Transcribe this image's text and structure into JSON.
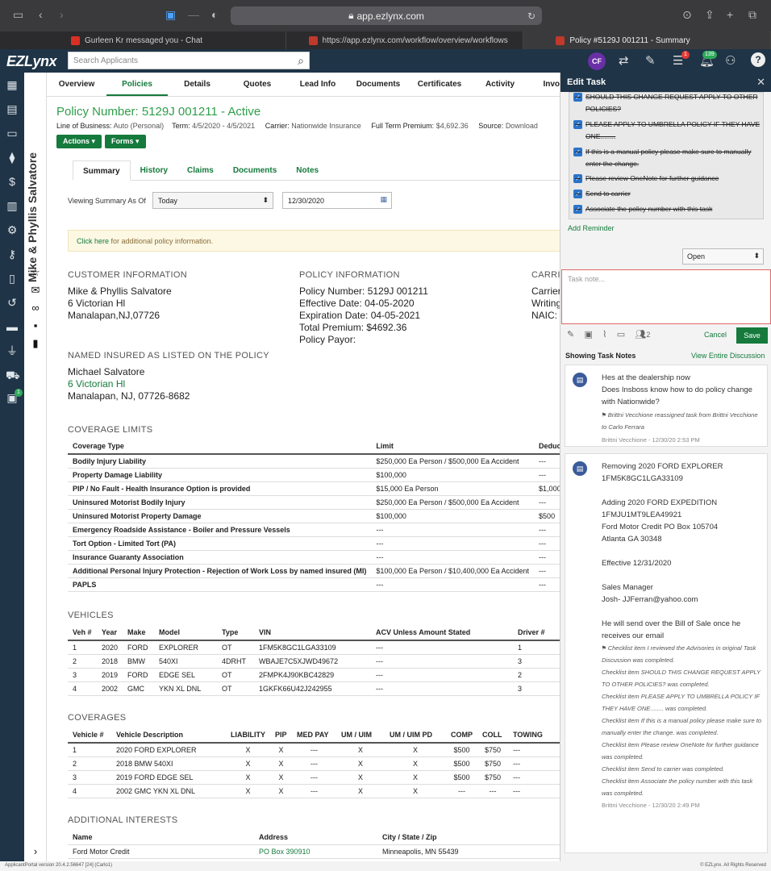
{
  "browser": {
    "url": "app.ezlynx.com",
    "tabs": [
      {
        "title": "Gurleen Kr messaged you - Chat"
      },
      {
        "title": "https://app.ezlynx.com/workflow/overview/workflows"
      },
      {
        "title": "Policy #5129J 001211 - Summary"
      }
    ]
  },
  "header": {
    "logo": "EZLynx",
    "search_placeholder": "Search Applicants",
    "avatar_initials": "CF",
    "list_badge": "1",
    "notif_badge": "139"
  },
  "sidebar_badge": "1",
  "client_name": "Mike & Phyllis Salvatore",
  "nav_tabs": [
    "Overview",
    "Policies",
    "Details",
    "Quotes",
    "Lead Info",
    "Documents",
    "Certificates",
    "Activity",
    "Invo"
  ],
  "policy": {
    "title": "Policy Number: 5129J 001211 - Active",
    "lob_label": "Line of Business:",
    "lob_value": "Auto (Personal)",
    "term_label": "Term:",
    "term_value": "4/5/2020 - 4/5/2021",
    "carrier_label": "Carrier:",
    "carrier_value": "Nationwide Insurance",
    "premium_label": "Full Term Premium:",
    "premium_value": "$4,692.36",
    "source_label": "Source:",
    "source_value": "Download",
    "actions_btn": "Actions",
    "forms_btn": "Forms"
  },
  "sub_tabs": [
    "Summary",
    "History",
    "Claims",
    "Documents",
    "Notes"
  ],
  "viewing": {
    "label": "Viewing Summary As Of",
    "select": "Today",
    "date": "12/30/2020"
  },
  "banner": {
    "link": "Click here",
    "text": " for additional policy information."
  },
  "customer_info": {
    "heading": "CUSTOMER INFORMATION",
    "name": "Mike & Phyllis Salvatore",
    "address1": "6 Victorian Hl",
    "address2": "Manalapan,NJ,07726"
  },
  "policy_info": {
    "heading": "POLICY INFORMATION",
    "number": "Policy Number: 5129J 001211",
    "effective": "Effective Date: 04-05-2020",
    "expiration": "Expiration Date: 04-05-2021",
    "premium": "Total Premium: $4692.36",
    "payor": "Policy Payor:"
  },
  "carrier_info": {
    "heading": "CARRI",
    "l1": "Carrier",
    "l2": "Writing",
    "l3": "NAIC:"
  },
  "named_insured": {
    "heading": "NAMED INSURED AS LISTED ON THE POLICY",
    "name": "Michael Salvatore",
    "address1": "6 Victorian Hl",
    "address2": "Manalapan, NJ, 07726-8682"
  },
  "coverage_limits": {
    "heading": "COVERAGE LIMITS",
    "columns": [
      "Coverage Type",
      "Limit",
      "Deductible"
    ],
    "rows": [
      [
        "Bodily Injury Liability",
        "$250,000 Ea Person / $500,000 Ea Accident",
        "---"
      ],
      [
        "Property Damage Liability",
        "$100,000",
        "---"
      ],
      [
        "PIP / No Fault - Health Insurance Option is provided",
        "$15,000 Ea Person",
        "$1,000"
      ],
      [
        "Uninsured Motorist Bodily Injury",
        "$250,000 Ea Person / $500,000 Ea Accident",
        "---"
      ],
      [
        "Uninsured Motorist Property Damage",
        "$100,000",
        "$500"
      ],
      [
        "Emergency Roadside Assistance - Boiler and Pressure Vessels",
        "---",
        "---"
      ],
      [
        "Tort Option - Limited Tort (PA)",
        "---",
        "---"
      ],
      [
        "Insurance Guaranty Association",
        "---",
        "---"
      ],
      [
        "Additional Personal Injury Protection - Rejection of Work Loss by named insured (MI)",
        "$100,000 Ea Person / $10,400,000 Ea Accident",
        "---"
      ],
      [
        "PAPLS",
        "---",
        "---"
      ]
    ]
  },
  "vehicles": {
    "heading": "VEHICLES",
    "columns": [
      "Veh #",
      "Year",
      "Make",
      "Model",
      "Type",
      "VIN",
      "ACV Unless Amount Stated",
      "Driver #"
    ],
    "rows": [
      [
        "1",
        "2020",
        "FORD",
        "EXPLORER",
        "OT",
        "1FM5K8GC1LGA33109",
        "---",
        "1"
      ],
      [
        "2",
        "2018",
        "BMW",
        "540XI",
        "4DRHT",
        "WBAJE7C5XJWD49672",
        "---",
        "3"
      ],
      [
        "3",
        "2019",
        "FORD",
        "EDGE SEL",
        "OT",
        "2FMPK4J90KBC42829",
        "---",
        "2"
      ],
      [
        "4",
        "2002",
        "GMC",
        "YKN XL DNL",
        "OT",
        "1GKFK66U42J242955",
        "---",
        "3"
      ]
    ]
  },
  "coverages": {
    "heading": "COVERAGES",
    "columns": [
      "Vehicle #",
      "Vehicle Description",
      "LIABILITY",
      "PIP",
      "MED PAY",
      "UM / UIM",
      "UM / UIM PD",
      "COMP",
      "COLL",
      "TOWING"
    ],
    "rows": [
      [
        "1",
        "2020 FORD EXPLORER",
        "X",
        "X",
        "---",
        "X",
        "X",
        "$500",
        "$750",
        "---"
      ],
      [
        "2",
        "2018 BMW 540XI",
        "X",
        "X",
        "---",
        "X",
        "X",
        "$500",
        "$750",
        "---"
      ],
      [
        "3",
        "2019 FORD EDGE SEL",
        "X",
        "X",
        "---",
        "X",
        "X",
        "$500",
        "$750",
        "---"
      ],
      [
        "4",
        "2002 GMC YKN XL DNL",
        "X",
        "X",
        "---",
        "X",
        "X",
        "---",
        "---",
        "---"
      ]
    ]
  },
  "additional_interests": {
    "heading": "ADDITIONAL INTERESTS",
    "columns": [
      "Name",
      "Address",
      "City / State / Zip"
    ],
    "rows": [
      [
        "Ford Motor Credit",
        "PO Box 390910",
        "Minneapolis, MN 55439"
      ]
    ]
  },
  "footer_left": "ApplicantPortal version 20.4.2.56647 [24] (Carlo1)",
  "footer_right": "© EZLynx. All Rights Reserved",
  "edit_task": {
    "title": "Edit Task",
    "checklist": [
      "SHOULD THIS CHANGE REQUEST APPLY TO OTHER POLICIES?",
      "PLEASE APPLY TO UMBRELLA POLICY IF THEY HAVE ONE........",
      "If this is a manual policy please make sure to manually enter the change.",
      "Please review OneNote for further guidance",
      "Send to carrier",
      "Associate the policy number with this task"
    ],
    "add_reminder": "Add Reminder",
    "status": "Open",
    "note_placeholder": "Task note...",
    "people_count": "2",
    "cancel": "Cancel",
    "save": "Save",
    "showing": "Showing Task Notes",
    "view_all": "View Entire Discussion",
    "notes": [
      {
        "lines": [
          "Hes at the dealership now",
          "Does Insboss know how to do policy change with Nationwide?"
        ],
        "meta": "Brittni  Vecchione reassigned task from Brittni Vecchione to Carlo Ferrara",
        "footer": "Brittni Vecchione - 12/30/20 2:53 PM"
      },
      {
        "lines": [
          "Removing 2020 FORD EXPLORER",
          "1FM5K8GC1LGA33109",
          "",
          "Adding 2020 FORD EXPEDITION",
          "1FMJU1MT9LEA49921",
          "Ford Motor Credit PO Box 105704",
          "Atlanta GA 30348",
          "",
          "Effective 12/31/2020",
          "",
          "Sales Manager",
          "Josh- JJFerran@yahoo.com",
          "",
          "He will send over the Bill of Sale once he receives our email"
        ],
        "meta": "Checklist item I reviewed the Advisories in original Task Discussion was completed.",
        "meta2": [
          "Checklist item SHOULD THIS CHANGE REQUEST APPLY TO OTHER POLICIES? was completed.",
          "Checklist item PLEASE APPLY TO UMBRELLA POLICY IF THEY HAVE ONE........ was completed.",
          "Checklist item If this is a manual policy please make sure to manually enter the change. was completed.",
          "Checklist item Please review OneNote for further guidance was completed.",
          "Checklist item Send to carrier was completed.",
          "Checklist item Associate the policy number with this task was completed."
        ],
        "footer": "Brittni Vecchione - 12/30/20 2:49 PM"
      }
    ]
  }
}
